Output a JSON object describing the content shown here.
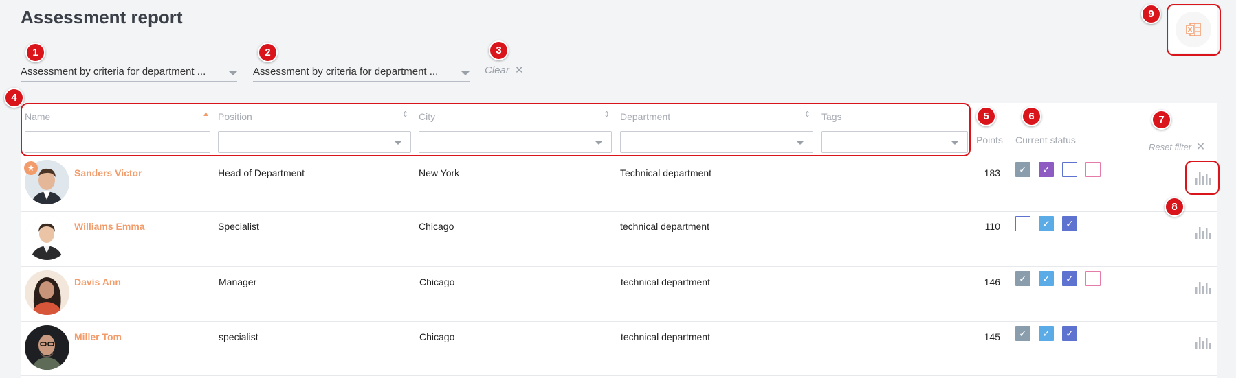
{
  "page_title": "Assessment report",
  "filters": {
    "dropdown1": "Assessment by criteria for department ...",
    "dropdown2": "Assessment by criteria for department ...",
    "clear_label": "Clear"
  },
  "badges": [
    "1",
    "2",
    "3",
    "4",
    "5",
    "6",
    "7",
    "8",
    "9"
  ],
  "table": {
    "columns": {
      "name": "Name",
      "position": "Position",
      "city": "City",
      "department": "Department",
      "tags": "Tags",
      "points": "Points",
      "status": "Current status"
    },
    "reset_filter": "Reset filter",
    "rows": [
      {
        "name": "Sanders Victor",
        "position": "Head of Department",
        "city": "New York",
        "department": "Technical department",
        "points": "183"
      },
      {
        "name": "Williams Emma",
        "position": "Specialist",
        "city": "Chicago",
        "department": "technical department",
        "points": "110"
      },
      {
        "name": "Davis Ann",
        "position": "Manager",
        "city": "Chicago",
        "department": "technical department",
        "points": "146"
      },
      {
        "name": "Miller Tom",
        "position": "specialist",
        "city": "Chicago",
        "department": "technical department",
        "points": "145"
      }
    ]
  },
  "icons": {
    "export": "excel-export-icon",
    "stats": "bar-chart-icon",
    "favorite": "star-icon"
  },
  "colors": {
    "accent": "#f39c6b",
    "annotation": "#d9141b",
    "status_gray": "#8a9dac",
    "status_purple": "#8e5bc2",
    "status_blue": "#5aabe6",
    "status_indigo": "#5e73cf",
    "status_outline_blue": "#5e73cf",
    "status_outline_pink": "#e57ba8"
  }
}
